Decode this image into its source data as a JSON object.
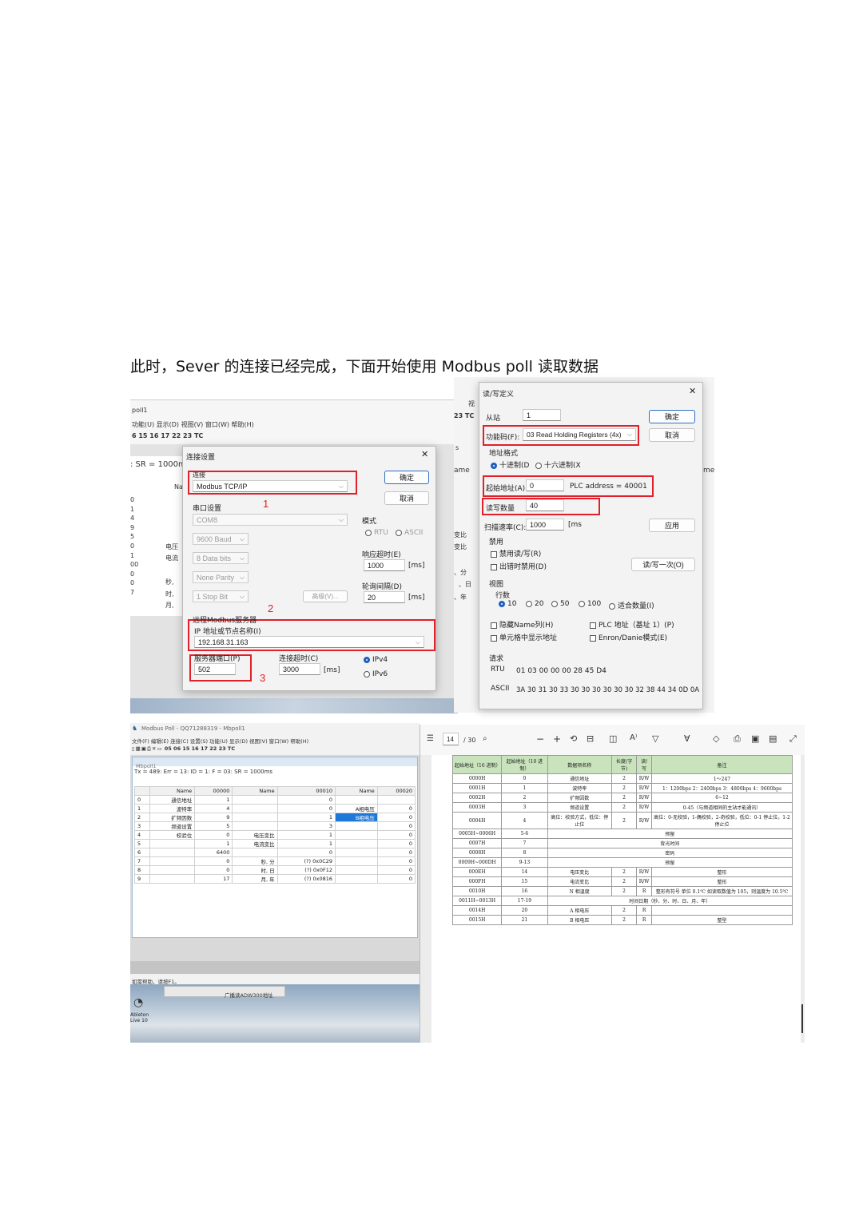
{
  "heading": "此时，Sever 的连接已经完成，下面开始使用 Modbus poll 读取数据",
  "connection_dialog": {
    "title": "连接设置",
    "conn_group": "连接",
    "conn_value": "Modbus TCP/IP",
    "ok": "确定",
    "cancel": "取消",
    "serial_group": "串口设置",
    "com": "COM8",
    "baud": "9600 Baud",
    "databits": "8 Data bits",
    "parity": "None Parity",
    "stopbit": "1 Stop Bit",
    "advanced": "高级(V)...",
    "mode_label": "模式",
    "rtu": "RTU",
    "ascii": "ASCII",
    "resp_timeout_label": "响应超时(E)",
    "resp_timeout_value": "1000",
    "ms": "[ms]",
    "poll_delay_label": "轮询间隔(D)",
    "poll_delay_value": "20",
    "remote_group": "远程Modbus服务器",
    "ip_label": "IP 地址或节点名称(I)",
    "ip_value": "192.168.31.163",
    "port_label": "服务器端口(P)",
    "port_value": "502",
    "conn_timeout_label": "连接超时(C)",
    "conn_timeout_value": "3000",
    "ipv4": "IPv4",
    "ipv6": "IPv6",
    "markers": [
      "1",
      "2",
      "3"
    ]
  },
  "poll_bg_top": {
    "title": "poll1",
    "menu": "功能(U)  显示(D)  视图(V)  窗口(W)  帮助(H)",
    "toolbar": "6 15 16 17 22 23  TC",
    "status": ": SR = 1000m",
    "col": "Na",
    "rows": [
      "0",
      "1",
      "4",
      "9",
      "5",
      "0",
      "1",
      "00",
      "0",
      "0",
      "7"
    ],
    "labels": [
      "电压",
      "电流",
      "秒,",
      "时,",
      "月,"
    ]
  },
  "rw_dialog": {
    "title": "读/写定义",
    "slave_label": "从站",
    "slave_value": "1",
    "ok": "确定",
    "cancel": "取消",
    "func_label": "功能码(F):",
    "func_value": "03 Read Holding Registers (4x)",
    "addr_fmt_label": "地址格式",
    "dec": "十进制(D",
    "hex": "十六进制(X",
    "start_label": "起始地址(A):",
    "start_value": "0",
    "plc_address": "PLC address = 40001",
    "qty_label": "读写数量",
    "qty_value": "40",
    "scan_label": "扫描速率(C):",
    "scan_value": "1000",
    "scan_unit": "[ms",
    "apply": "应用",
    "disable_label": "禁用",
    "disable_rw": "禁用读/写(R)",
    "disable_err": "出错时禁用(D)",
    "rw_once": "读/写一次(O)",
    "view_label": "视图",
    "rows_label": "行数",
    "rows_opts": [
      "10",
      "20",
      "50",
      "100",
      "适合数量(I)"
    ],
    "hide_name": "隐藏Name列(H)",
    "plc_base": "PLC 地址（基址 1）(P)",
    "addr_in_cell": "单元格中显示地址",
    "enron": "Enron/Danie模式(E)",
    "request_label": "请求",
    "rtu_label": "RTU",
    "rtu_value": "01 03 00 00 00 28 45 D4",
    "ascii_label": "ASCII",
    "ascii_value": "3A 30 31 30 33 30 30 30 30 30 30 32 38 44 34 0D 0A",
    "bg_fragments": [
      "23  TC",
      "ame",
      "变比",
      "变比",
      "、分",
      "、日",
      "、年",
      "me",
      "s",
      "视"
    ]
  },
  "poll_main": {
    "title": "Modbus Poll - QQ71288319 - Mbpoll1",
    "menu": "文件(F)  编辑(E)  连接(C)  设置(S)  功能(U)  显示(D)  视图(V)  窗口(W)  帮助(H)",
    "toolbar": "05 06 15 16 17 22 23  TC",
    "child_title": "Mbpoll1",
    "status": "Tx = 489: Err = 13: ID = 1: F = 03: SR = 1000ms",
    "headers": [
      "",
      "Name",
      "00000",
      "Name",
      "00010",
      "Name",
      "00020"
    ],
    "rows": [
      [
        "0",
        "通信地址",
        "1",
        "",
        "0",
        "",
        ""
      ],
      [
        "1",
        "波特率",
        "4",
        "",
        "0",
        "A相电压",
        "0"
      ],
      [
        "2",
        "扩频因数",
        "9",
        "",
        "1",
        "B相电压",
        "0"
      ],
      [
        "3",
        "频道设置",
        "5",
        "",
        "3",
        "",
        "0"
      ],
      [
        "4",
        "校验位",
        "0",
        "电压变比",
        "1",
        "",
        "0"
      ],
      [
        "5",
        "",
        "1",
        "电流变比",
        "1",
        "",
        "0"
      ],
      [
        "6",
        "",
        "6400",
        "",
        "0",
        "",
        "0"
      ],
      [
        "7",
        "",
        "0",
        "秒, 分",
        "(?) 0x0C29",
        "",
        "0"
      ],
      [
        "8",
        "",
        "0",
        "时, 日",
        "(?) 0x0F12",
        "",
        "0"
      ],
      [
        "9",
        "",
        "17",
        "月, 年",
        "(?) 0x0816",
        "",
        "0"
      ]
    ],
    "help": "如需帮助，请按F1。",
    "taskbar_item": "广播读ADW300地址",
    "desktop_icon": "Ableton Live 10"
  },
  "pdf_viewer": {
    "page": "14",
    "total": "/ 30",
    "headers": [
      "起始地址（16 进制）",
      "起始地址（10 进制）",
      "数据项名称",
      "长度(字节)",
      "读/写",
      "备注"
    ],
    "rows": [
      [
        "0000H",
        "0",
        "通信地址",
        "2",
        "R/W",
        "1～247"
      ],
      [
        "0001H",
        "1",
        "波特率",
        "2",
        "R/W",
        "1：1200bps 2：2400bps 3：4800bps 4：9600bps"
      ],
      [
        "0002H",
        "2",
        "扩频因数",
        "2",
        "R/W",
        "6~12"
      ],
      [
        "0003H",
        "3",
        "频道设置",
        "2",
        "R/W",
        "0-45（与频道相同的主站才能通讯）"
      ],
      [
        "0004H",
        "4",
        "高位：校验方式，低位：停止位",
        "2",
        "R/W",
        "高位：0-无校验，1-偶校验，2-奇校验，低位：0-1 停止位，1-2 停止位"
      ],
      [
        "0005H~0006H",
        "5-6",
        "预留",
        "",
        "",
        ""
      ],
      [
        "0007H",
        "7",
        "背光时间",
        "",
        "",
        ""
      ],
      [
        "0008H",
        "8",
        "密码",
        "",
        "",
        ""
      ],
      [
        "0009H~000DH",
        "9-13",
        "预留",
        "",
        "",
        ""
      ],
      [
        "000EH",
        "14",
        "电压变比",
        "2",
        "R/W",
        "整形"
      ],
      [
        "000FH",
        "15",
        "电流变比",
        "2",
        "R/W",
        "整形"
      ],
      [
        "0010H",
        "16",
        "N 相温度",
        "2",
        "R",
        "整形有符号 单位 0.1℃ 如读取数值为 105，则温度为 10.5℃"
      ],
      [
        "0011H~0013H",
        "17-19",
        "时间日期（秒、分、时、日、月、年）",
        "",
        "",
        ""
      ],
      [
        "0014H",
        "20",
        "A 相电压",
        "2",
        "R",
        ""
      ],
      [
        "0015H",
        "21",
        "B 相电压",
        "2",
        "R",
        "整型"
      ]
    ]
  }
}
